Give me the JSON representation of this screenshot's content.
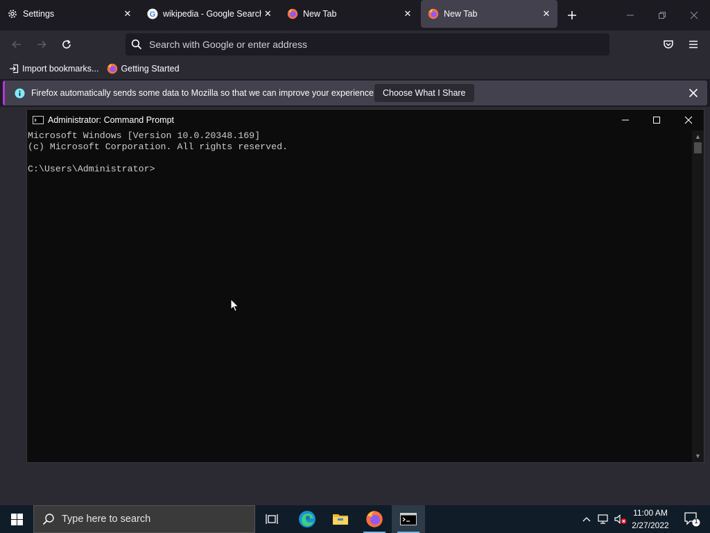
{
  "browser": {
    "tabs": [
      {
        "label": "Settings",
        "icon": "gear-icon",
        "active": false
      },
      {
        "label": "wikipedia - Google Search",
        "icon": "google-icon",
        "active": false
      },
      {
        "label": "New Tab",
        "icon": "firefox-icon",
        "active": false
      },
      {
        "label": "New Tab",
        "icon": "firefox-icon",
        "active": true
      }
    ],
    "urlbar": {
      "placeholder": "Search with Google or enter address"
    },
    "bookmarks": [
      {
        "label": "Import bookmarks...",
        "icon": "import-icon"
      },
      {
        "label": "Getting Started",
        "icon": "firefox-icon"
      }
    ],
    "notification": {
      "text": "Firefox automatically sends some data to Mozilla so that we can improve your experience.",
      "button": "Choose What I Share"
    },
    "colors": {
      "accent": "#b833e1",
      "toolbar": "#2b2a33",
      "tabstrip": "#1c1b22"
    }
  },
  "cmd": {
    "title": "Administrator: Command Prompt",
    "lines": [
      "Microsoft Windows [Version 10.0.20348.169]",
      "(c) Microsoft Corporation. All rights reserved.",
      "",
      "C:\\Users\\Administrator>"
    ]
  },
  "taskbar": {
    "search_placeholder": "Type here to search",
    "apps": [
      "task-view-icon",
      "edge-icon",
      "file-explorer-icon",
      "firefox-icon",
      "command-prompt-icon"
    ],
    "clock": {
      "time": "11:00 AM",
      "date": "2/27/2022"
    },
    "notification_count": "1"
  }
}
